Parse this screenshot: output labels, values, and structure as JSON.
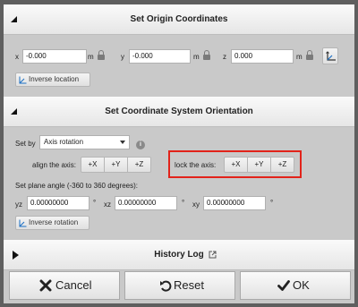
{
  "origin_panel": {
    "title": "Set Origin Coordinates",
    "x_label": "x",
    "x_value": "-0.000",
    "x_unit": "m",
    "y_label": "y",
    "y_value": "-0.000",
    "y_unit": "m",
    "z_label": "z",
    "z_value": "0.000",
    "z_unit": "m",
    "inverse_label": "Inverse location"
  },
  "orientation_panel": {
    "title": "Set Coordinate System Orientation",
    "set_by_label": "Set by",
    "set_by_value": "Axis rotation",
    "align_label": "align the axis:",
    "lock_label": "lock the axis:",
    "axis_buttons": [
      "+X",
      "+Y",
      "+Z"
    ],
    "plane_angle_label": "Set plane angle (-360 to 360 degrees):",
    "yz_label": "yz",
    "yz_value": "0.00000000",
    "xz_label": "xz",
    "xz_value": "0.00000000",
    "xy_label": "xy",
    "xy_value": "0.00000000",
    "degree_unit": "°",
    "inverse_label": "Inverse rotation"
  },
  "history_panel": {
    "title": "History Log"
  },
  "footer": {
    "cancel": "Cancel",
    "reset": "Reset",
    "ok": "OK"
  },
  "colors": {
    "highlight": "#e2231a",
    "background": "#c9c9c9"
  },
  "icons": [
    "lock-icon",
    "axes-icon",
    "inverse-icon",
    "info-icon",
    "external-link-icon",
    "x-icon",
    "undo-icon",
    "check-icon"
  ]
}
